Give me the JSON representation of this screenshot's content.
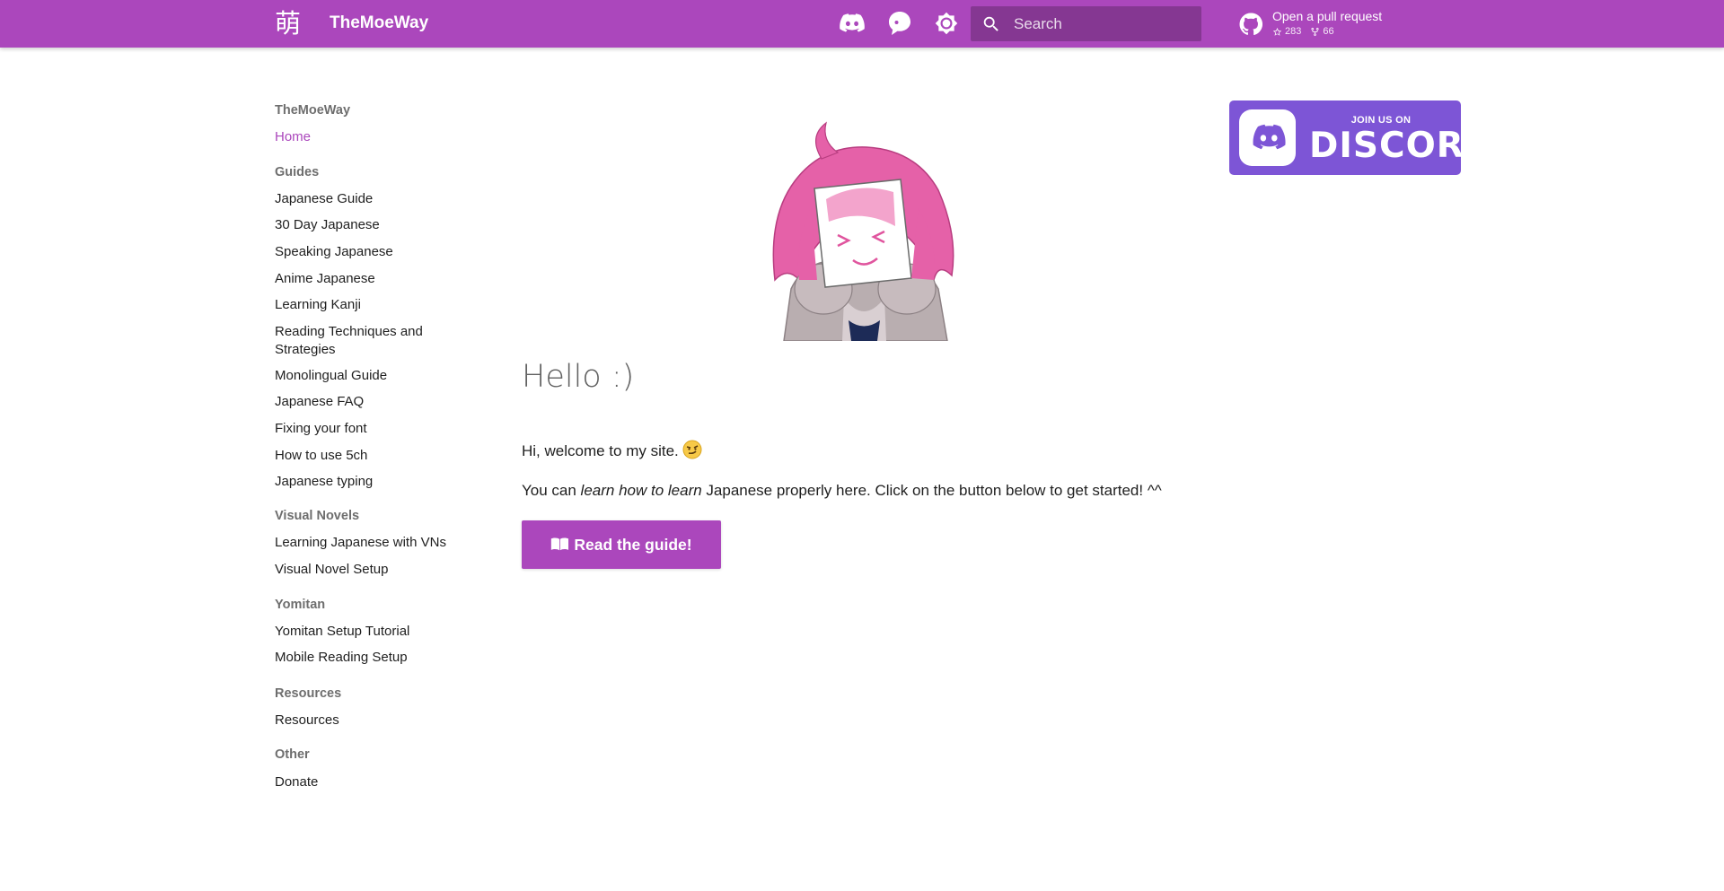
{
  "header": {
    "logo_glyph": "萌",
    "site_title": "TheMoeWay",
    "search_placeholder": "Search",
    "repo_name": "Open a pull request",
    "repo_stars": "283",
    "repo_forks": "66"
  },
  "sidebar": {
    "site": "TheMoeWay",
    "home": "Home",
    "sections": {
      "guides": {
        "title": "Guides",
        "items": [
          "Japanese Guide",
          "30 Day Japanese",
          "Speaking Japanese",
          "Anime Japanese",
          "Learning Kanji",
          "Reading Techniques and",
          "Strategies",
          "Monolingual Guide",
          "Japanese FAQ",
          "Fixing your font",
          "How to use 5ch",
          "Japanese typing"
        ]
      },
      "visual_novels": {
        "title": "Visual Novels",
        "items": [
          "Learning Japanese with VNs",
          "Visual Novel Setup"
        ]
      },
      "yomitan": {
        "title": "Yomitan",
        "items": [
          "Yomitan Setup Tutorial",
          "Mobile Reading Setup"
        ]
      },
      "resources": {
        "title": "Resources",
        "items": [
          "Resources"
        ]
      },
      "other": {
        "title": "Other",
        "items": [
          "Donate"
        ]
      }
    }
  },
  "main": {
    "title": "Hello :)",
    "welcome": "Hi, welcome to my site.",
    "intro_before": "You can ",
    "intro_em": "learn how to learn",
    "intro_after": " Japanese properly here. Click on the button below to get started! ^^",
    "button_label": "Read the guide!"
  },
  "discord_banner": {
    "small_text": "JOIN US ON",
    "big_text": "DISCORD"
  },
  "colors": {
    "primary": "#ab47bc",
    "discord": "#7d55d6",
    "section_title": "#6e6e6e"
  },
  "icons": {
    "discord": "discord-icon",
    "palette": "palette-icon",
    "theme": "brightness-icon",
    "search": "search-icon",
    "github": "github-icon",
    "star": "star-icon",
    "fork": "fork-icon",
    "book": "book-open-icon"
  }
}
